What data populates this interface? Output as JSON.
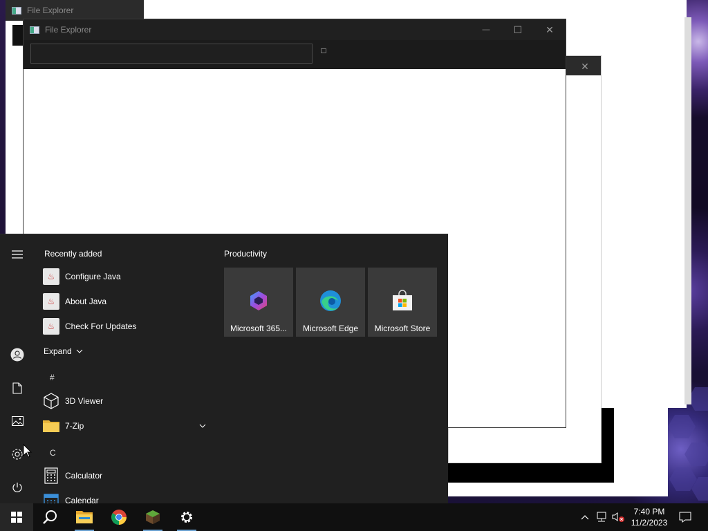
{
  "windows": {
    "back": {
      "title": "File Explorer"
    },
    "main": {
      "title": "File Explorer",
      "address_value": "",
      "minimize_glyph": "—",
      "maximize_glyph": "☐",
      "close_glyph": "✕"
    },
    "mid": {
      "close_glyph": "✕"
    }
  },
  "start_menu": {
    "recently_added_label": "Recently added",
    "recent_items": [
      {
        "label": "Configure Java",
        "icon": "java-icon"
      },
      {
        "label": "About Java",
        "icon": "java-icon"
      },
      {
        "label": "Check For Updates",
        "icon": "java-icon"
      }
    ],
    "expand_label": "Expand",
    "groups": [
      {
        "letter": "#",
        "items": [
          {
            "label": "3D Viewer",
            "icon": "3d-viewer-icon"
          },
          {
            "label": "7-Zip",
            "icon": "folder-icon"
          }
        ]
      },
      {
        "letter": "C",
        "items": [
          {
            "label": "Calculator",
            "icon": "calculator-icon"
          },
          {
            "label": "Calendar",
            "icon": "calendar-icon"
          }
        ]
      }
    ],
    "tiles_group_label": "Productivity",
    "tiles": [
      {
        "label": "Microsoft 365...",
        "icon": "microsoft-365-icon"
      },
      {
        "label": "Microsoft Edge",
        "icon": "edge-icon"
      },
      {
        "label": "Microsoft Store",
        "icon": "store-icon"
      }
    ]
  },
  "taskbar": {
    "pinned": [
      "search-icon",
      "file-explorer-icon",
      "chrome-icon",
      "minecraft-icon",
      "settings-icon"
    ],
    "clock_time": "7:40 PM",
    "clock_date": "11/2/2023",
    "accent_color": "#6aa0d0"
  }
}
